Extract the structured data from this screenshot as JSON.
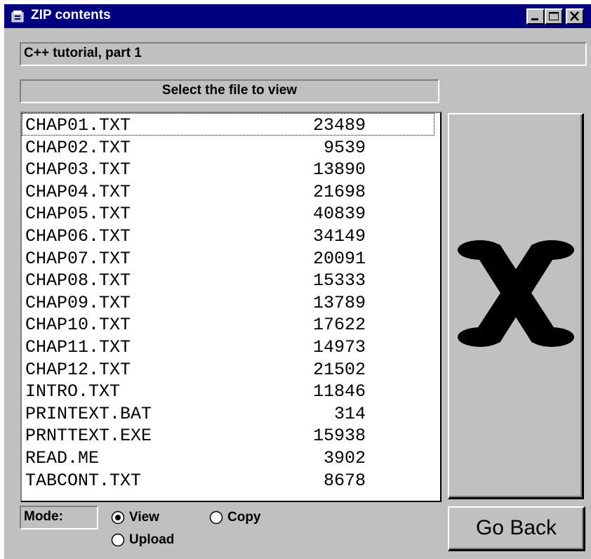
{
  "window": {
    "title": "ZIP contents",
    "icon": "zip-app-icon",
    "controls": [
      "minimize-icon",
      "maximize-icon",
      "close-icon"
    ]
  },
  "zip_name": "C++ tutorial, part 1",
  "instruction": "Select the file to view",
  "files": [
    {
      "name": "CHAP01.TXT",
      "size": "23489"
    },
    {
      "name": "CHAP02.TXT",
      "size": "9539"
    },
    {
      "name": "CHAP03.TXT",
      "size": "13890"
    },
    {
      "name": "CHAP04.TXT",
      "size": "21698"
    },
    {
      "name": "CHAP05.TXT",
      "size": "40839"
    },
    {
      "name": "CHAP06.TXT",
      "size": "34149"
    },
    {
      "name": "CHAP07.TXT",
      "size": "20091"
    },
    {
      "name": "CHAP08.TXT",
      "size": "15333"
    },
    {
      "name": "CHAP09.TXT",
      "size": "13789"
    },
    {
      "name": "CHAP10.TXT",
      "size": "17622"
    },
    {
      "name": "CHAP11.TXT",
      "size": "14973"
    },
    {
      "name": "CHAP12.TXT",
      "size": "21502"
    },
    {
      "name": "INTRO.TXT",
      "size": "11846"
    },
    {
      "name": "PRINTEXT.BAT",
      "size": "314"
    },
    {
      "name": "PRNTTEXT.EXE",
      "size": "15938"
    },
    {
      "name": "READ.ME",
      "size": "3902"
    },
    {
      "name": "TABCONT.TXT",
      "size": "8678"
    }
  ],
  "action_button": {
    "icon": "x-icon"
  },
  "mode": {
    "label": "Mode:",
    "options": [
      {
        "label": "View",
        "selected": true
      },
      {
        "label": "Copy",
        "selected": false
      },
      {
        "label": "Upload",
        "selected": false
      }
    ]
  },
  "go_back_label": "Go Back",
  "colors": {
    "titlebar": "#000080",
    "face": "#c0c0c0",
    "list_background": "#ffffff"
  }
}
